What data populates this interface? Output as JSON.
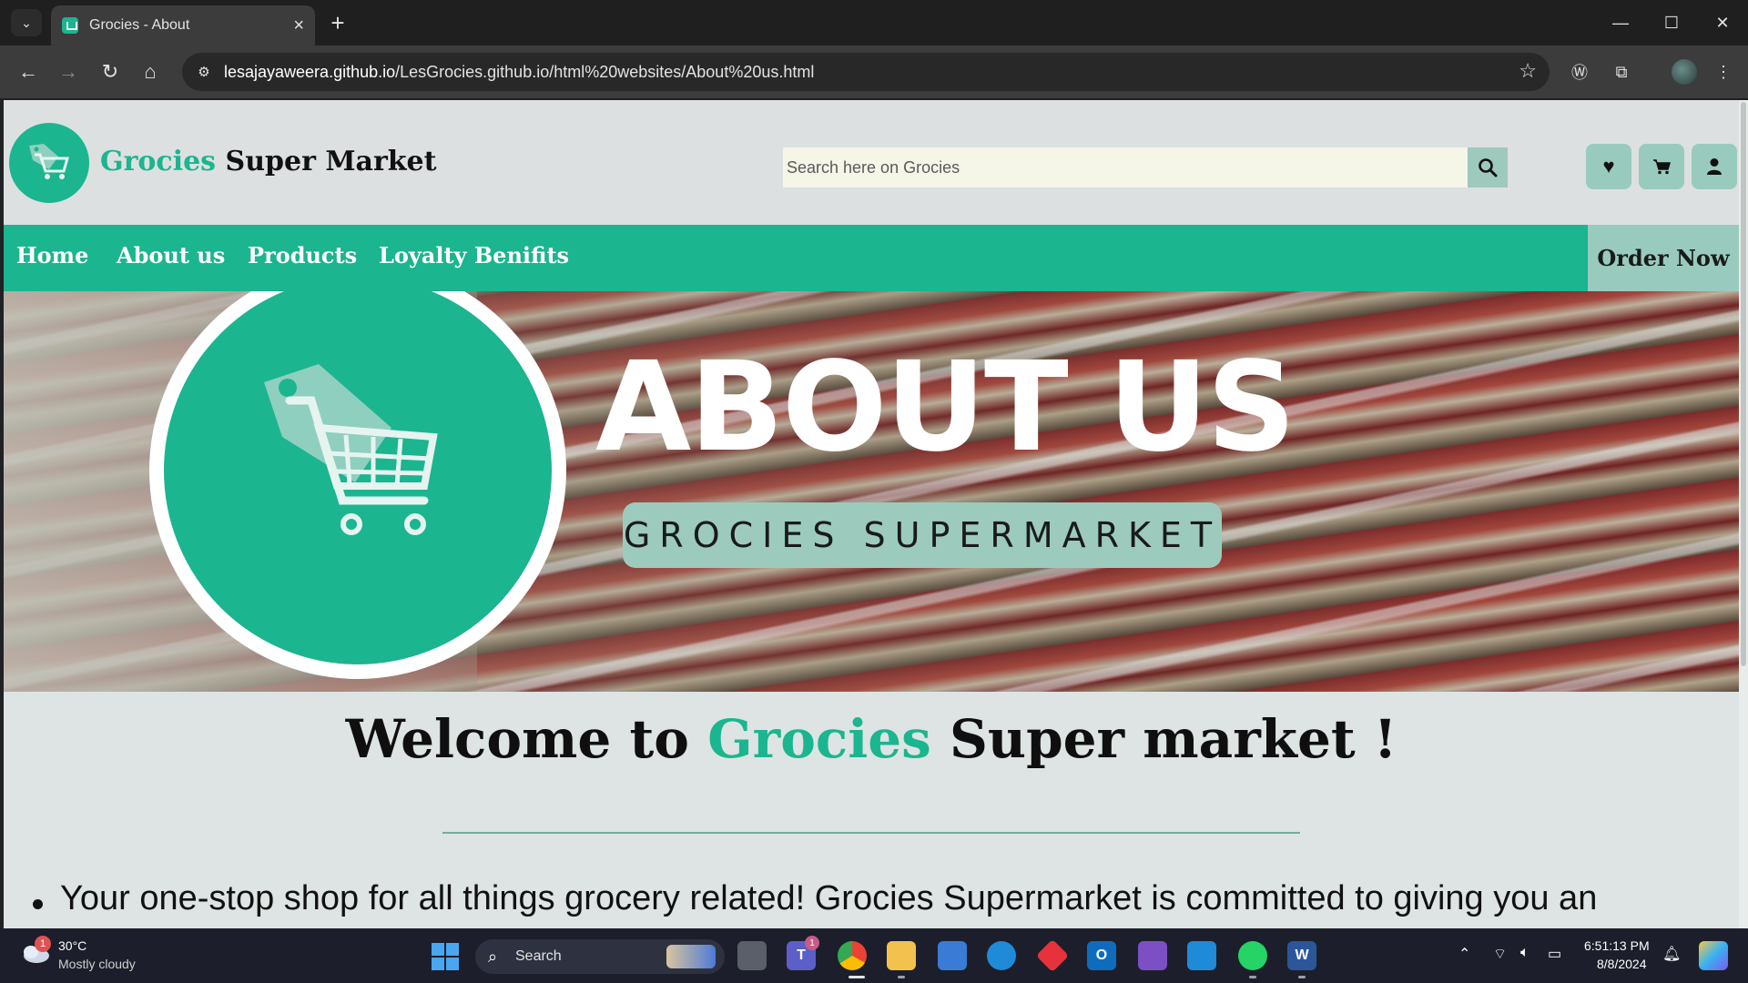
{
  "browser": {
    "tab_title": "Grocies - About",
    "url_host": "lesajayaweera.github.io",
    "url_path": "/LesGrocies.github.io/html%20websites/About%20us.html"
  },
  "site": {
    "brand_accent": "Grocies",
    "brand_rest": " Super Market",
    "search_placeholder": "Search here on Grocies",
    "nav": [
      "Home",
      "About us",
      "Products",
      "Loyalty Benifits"
    ],
    "order_label": "Order Now",
    "accent_color": "#1bb58f",
    "soft_accent_color": "#98cbbd"
  },
  "hero": {
    "title": "ABOUT US",
    "badge": "GROCIES SUPERMARKET"
  },
  "content": {
    "welcome_pre": "Welcome to ",
    "welcome_accent": "Grocies",
    "welcome_post": " Super market !",
    "bullet_1": "Your one-stop shop for all things grocery related! Grocies Supermarket is committed to giving you an"
  },
  "taskbar": {
    "weather_temp": "30°C",
    "weather_desc": "Mostly cloudy",
    "weather_badge": "1",
    "search_label": "Search",
    "teams_badge": "1",
    "time": "6:51:13 PM",
    "date": "8/8/2024"
  }
}
